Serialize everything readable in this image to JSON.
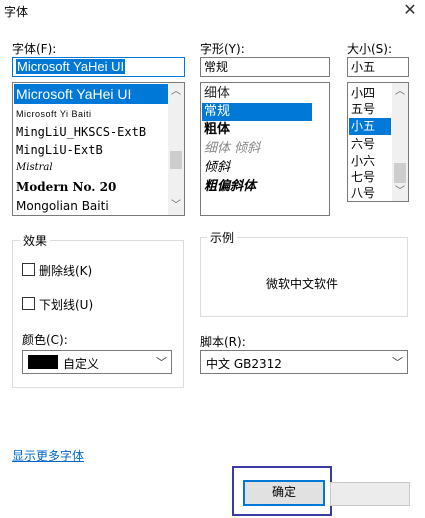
{
  "window": {
    "title": "字体",
    "close_glyph": "✕"
  },
  "font": {
    "label": "字体(F):",
    "value": "Microsoft YaHei UI",
    "items": [
      "Microsoft YaHei UI",
      "Microsoft Yi Baiti",
      "MingLiU_HKSCS-ExtB",
      "MingLiU-ExtB",
      "Mistral",
      "Modern No. 20",
      "Mongolian Baiti"
    ],
    "selected_index": 0
  },
  "style": {
    "label": "字形(Y):",
    "value": "常规",
    "items": [
      "细体",
      "常规",
      "粗体",
      "细体 倾斜",
      "倾斜",
      "粗偏斜体"
    ],
    "selected_index": 1
  },
  "size": {
    "label": "大小(S):",
    "value": "小五",
    "items": [
      "小四",
      "五号",
      "小五",
      "六号",
      "小六",
      "七号",
      "八号"
    ],
    "selected_index": 2
  },
  "effects": {
    "label": "效果",
    "strikeout_label": "删除线(K)",
    "underline_label": "下划线(U)",
    "color_label": "颜色(C):",
    "color_value": "自定义",
    "color_swatch": "#000000"
  },
  "sample": {
    "label": "示例",
    "text": "微软中文软件"
  },
  "script": {
    "label": "脚本(R):",
    "value": "中文 GB2312"
  },
  "more_fonts_link": "显示更多字体",
  "buttons": {
    "ok": "确定"
  },
  "colors": {
    "accent": "#0078d7",
    "highlight_box": "#3a3aa0",
    "link": "#0066cc"
  }
}
